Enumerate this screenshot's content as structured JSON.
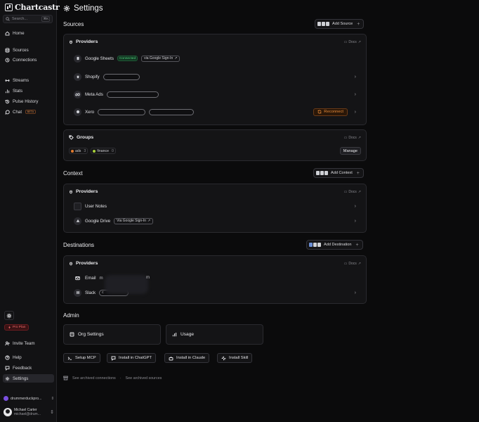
{
  "app": {
    "name": "Chartcastr"
  },
  "sidebar": {
    "search_placeholder": "Search...",
    "search_kbd": "⌘K",
    "items": [
      {
        "label": "Home"
      },
      {
        "label": "Sources"
      },
      {
        "label": "Connections"
      },
      {
        "label": "Streams"
      },
      {
        "label": "Stats"
      },
      {
        "label": "Pulse History"
      },
      {
        "label": "Chat",
        "badge": "BETA"
      }
    ],
    "pro_plan": "Pro Plan",
    "bottom_items": [
      {
        "label": "Invite Team"
      },
      {
        "label": "Help"
      },
      {
        "label": "Feedback"
      },
      {
        "label": "Settings"
      }
    ],
    "workspace": "drummerduckpro...",
    "user": {
      "name": "Michael Carter",
      "email": "michael@drum..."
    }
  },
  "page": {
    "title": "Settings"
  },
  "sources": {
    "heading": "Sources",
    "add_label": "Add Source",
    "card_title": "Providers",
    "docs": "Docs",
    "rows": [
      {
        "name": "Google Sheets",
        "status": "Connected",
        "via": "via Google Sign-In"
      },
      {
        "name": "Shopify"
      },
      {
        "name": "Meta Ads"
      },
      {
        "name": "Xero",
        "action": "Reconnect"
      }
    ]
  },
  "groups": {
    "title": "Groups",
    "docs": "Docs",
    "tags": [
      {
        "name": "ads",
        "count": "3",
        "color": "#e07a2e"
      },
      {
        "name": "finance",
        "count": "0",
        "color": "#a6cf3a"
      }
    ],
    "manage_label": "Manage"
  },
  "context": {
    "heading": "Context",
    "add_label": "Add Context",
    "card_title": "Providers",
    "docs": "Docs",
    "rows": [
      {
        "name": "User Notes"
      },
      {
        "name": "Google Drive",
        "via": "Via Google Sign-In"
      }
    ]
  },
  "destinations": {
    "heading": "Destinations",
    "add_label": "Add Destination",
    "card_title": "Providers",
    "docs": "Docs",
    "rows": [
      {
        "name": "Email",
        "value_start": "m",
        "value_end": "m"
      },
      {
        "name": "Slack",
        "value_start": "c"
      }
    ]
  },
  "admin": {
    "heading": "Admin",
    "cards": [
      {
        "label": "Org Settings"
      },
      {
        "label": "Usage"
      }
    ],
    "actions": [
      {
        "label": "Setup MCP"
      },
      {
        "label": "Install in ChatGPT"
      },
      {
        "label": "Install in Claude"
      },
      {
        "label": "Install Skill"
      }
    ],
    "links": [
      {
        "label": "See archived connections"
      },
      {
        "label": "See archived sources"
      }
    ],
    "separator": "·"
  }
}
